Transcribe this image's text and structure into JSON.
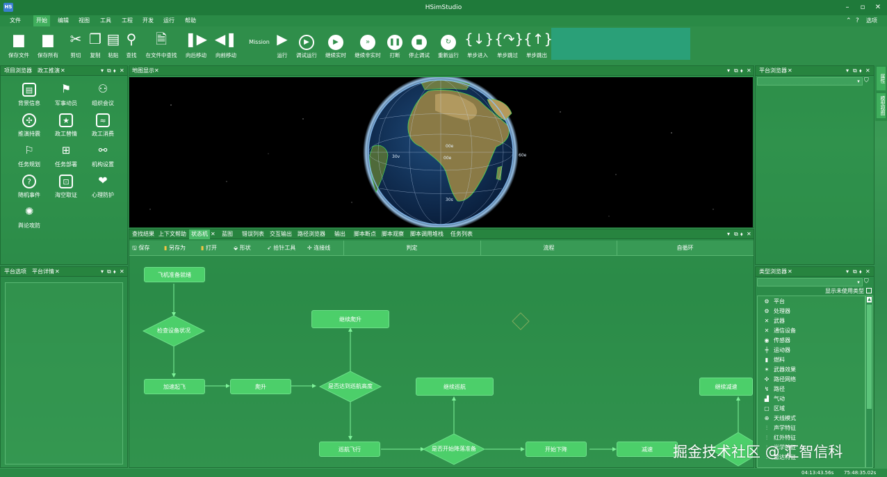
{
  "window": {
    "title": "HSimStudio",
    "icon_text": "HS",
    "options_label": "选项"
  },
  "menu": [
    "文件",
    "开始",
    "编辑",
    "视图",
    "工具",
    "工程",
    "开发",
    "运行",
    "帮助"
  ],
  "menu_active_index": 1,
  "toolbar": {
    "save_file": "保存文件",
    "save_all": "保存所有",
    "cut": "剪切",
    "copy": "复制",
    "paste": "粘贴",
    "find": "查找",
    "find_in_files": "在文件中查找",
    "move_back": "向后移动",
    "move_forward": "向前移动",
    "mission": "Mission",
    "run": "运行",
    "debug_run": "调试运行",
    "continue_realtime": "继续实时",
    "continue_nonrealtime": "继续非实时",
    "break": "打断",
    "stop_debug": "停止调试",
    "rerun": "重新运行",
    "step_into": "单步进入",
    "step_over": "单步跳过",
    "step_out": "单步跳出"
  },
  "project_panel": {
    "tabs": [
      "项目浏览器",
      "政工推演"
    ],
    "items": [
      "背景信息",
      "军事动员",
      "组织会议",
      "推演持震",
      "政工替情",
      "政工消费",
      "任务规划",
      "任务部署",
      "机构设置",
      "随机事件",
      "海空取证",
      "心理防护",
      "舆论攻防"
    ]
  },
  "platform_options_panel": {
    "tabs": [
      "平台选项",
      "平台详情"
    ]
  },
  "map_panel": {
    "tabs": [
      "地图显示"
    ],
    "grid_labels": {
      "lat_0": "00e",
      "lon_30w": "30v",
      "lon_0": "00e",
      "lon_60e": "60e",
      "lat_30s": "30s"
    }
  },
  "bottom_panel": {
    "tabs": [
      "查找结果",
      "上下文帮助",
      "状态机",
      "蓝图",
      "错误列表",
      "交互输出",
      "路径浏览器",
      "输出",
      "脚本断点",
      "脚本观察",
      "脚本调用堆栈",
      "任务列表"
    ],
    "active_tab_index": 2,
    "toolbar": {
      "save": "保存",
      "save_as": "另存为",
      "open": "打开",
      "shape": "形状",
      "pick_tool": "拾针工具",
      "connect": "连接线"
    },
    "columns": [
      "判定",
      "流程",
      "自循环"
    ]
  },
  "state_machine": {
    "nodes": {
      "n_prepare": "飞机准备就绪",
      "n_check": "检查设备状况",
      "n_accel": "加速起飞",
      "n_climb": "爬升",
      "n_reach_alt": "是否达到巡航高度",
      "n_keep_climb": "继续爬升",
      "n_cruise": "巡航飞行",
      "n_keep_cruise": "继续巡航",
      "n_start_descent": "是否开始降落准备",
      "n_descend": "开始下降",
      "n_decel": "减速",
      "n_keep_decel": "继续减速"
    }
  },
  "platform_browser": {
    "tabs": [
      "平台浏览器"
    ]
  },
  "right_strip": {
    "items": [
      "属性",
      "模型视图"
    ]
  },
  "type_browser": {
    "tabs": [
      "类型浏览器"
    ],
    "show_unused_label": "显示未使用类型",
    "items": [
      {
        "label": "平台",
        "icon": "platform-icon",
        "glyph": "⚙"
      },
      {
        "label": "处理器",
        "icon": "processor-icon",
        "glyph": "⚙"
      },
      {
        "label": "武器",
        "icon": "weapon-icon",
        "glyph": "✕"
      },
      {
        "label": "通信设备",
        "icon": "comm-icon",
        "glyph": "✕"
      },
      {
        "label": "传感器",
        "icon": "sensor-icon",
        "glyph": "◉"
      },
      {
        "label": "运动器",
        "icon": "mover-icon",
        "glyph": "╪"
      },
      {
        "label": "燃料",
        "icon": "fuel-icon",
        "glyph": "▮"
      },
      {
        "label": "武器效果",
        "icon": "weapon-effect-icon",
        "glyph": "✶"
      },
      {
        "label": "路径网络",
        "icon": "route-network-icon",
        "glyph": "✣"
      },
      {
        "label": "路径",
        "icon": "route-icon",
        "glyph": "↯"
      },
      {
        "label": "气动",
        "icon": "aero-icon",
        "glyph": "▟"
      },
      {
        "label": "区域",
        "icon": "zone-icon",
        "glyph": "▢"
      },
      {
        "label": "天线模式",
        "icon": "antenna-icon",
        "glyph": "⊕"
      },
      {
        "label": "声学特征",
        "icon": "acoustic-icon",
        "glyph": "⫶"
      },
      {
        "label": "红外特征",
        "icon": "infrared-icon",
        "glyph": "⫶"
      },
      {
        "label": "光学特征",
        "icon": "optical-icon",
        "glyph": "⫶"
      },
      {
        "label": "雷达特征",
        "icon": "radar-icon",
        "glyph": "⫶"
      }
    ]
  },
  "watermark": "掘金技术社区 @ 汇智信科",
  "status": {
    "time1": "04:13:43.56s",
    "time2": "75:48:35.02s"
  },
  "colors": {
    "accent": "#48b866",
    "node": "#4ccf6a",
    "title": "#1f7a3a"
  }
}
